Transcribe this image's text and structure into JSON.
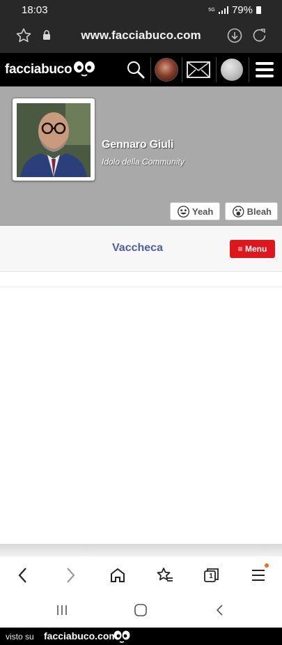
{
  "status_bar": {
    "time": "18:03",
    "network": "5G",
    "battery": "79%"
  },
  "browser": {
    "url": "www.facciabuco.com"
  },
  "site_header": {
    "logo_text": "facciabuco",
    "icons": [
      "eyes-logo-icon",
      "search-icon",
      "avatar",
      "mail-icon",
      "moon-icon",
      "hamburger-menu-icon"
    ]
  },
  "profile": {
    "name": "Gennaro Giuli",
    "subtitle": "Idolo della Community",
    "reactions": {
      "yeah_label": "Yeah",
      "bleah_label": "Bleah"
    }
  },
  "section": {
    "title": "Vaccheca",
    "menu_label": "≡ Menu"
  },
  "browser_toolbar": {
    "tab_count": "1",
    "icons": [
      "back-icon",
      "forward-icon",
      "home-icon",
      "bookmarks-icon",
      "tabs-icon",
      "menu-icon"
    ]
  },
  "footer": {
    "prefix": "visto su",
    "brand": "facciabuco.com"
  },
  "colors": {
    "header_bg": "#000000",
    "profile_bg": "#a9a9a9",
    "section_title": "#4b5fa5",
    "menu_button": "#e0161d",
    "notification_dot": "#f26b21"
  }
}
